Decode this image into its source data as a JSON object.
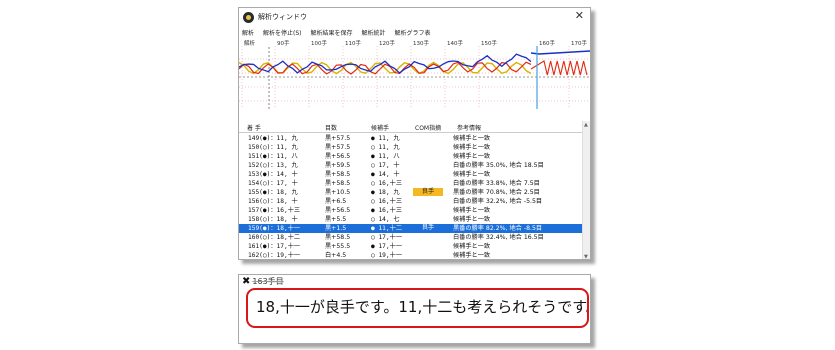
{
  "window": {
    "title": "解析ウィンドウ",
    "menu": [
      "解析",
      "解析を停止(S)",
      "解析結果を保存",
      "解析統計",
      "解析グラフ表"
    ]
  },
  "graph": {
    "move_ticks": [
      "解析",
      "90手",
      "100手",
      "110手",
      "120手",
      "130手",
      "140手",
      "150手",
      "160手",
      "170手"
    ],
    "colors": {
      "black_line": "#1a2fc4",
      "white_line": "#e02a12",
      "extra_line": "#d8b200",
      "grid_dots": "#e58a8a",
      "cursor": "#4aa0e8"
    }
  },
  "table": {
    "headers": {
      "move": "着 手",
      "score": "目数",
      "candidate": "候補手",
      "com": "COM指摘",
      "info": "参考情報"
    },
    "rows": [
      {
        "move": "149(●)：11, 九",
        "score": "黒+57.5",
        "cand": "● 11, 九",
        "com": "",
        "info": "候補手と一致"
      },
      {
        "move": "150(○)：11, 九",
        "score": "黒+57.5",
        "cand": "○ 11, 九",
        "com": "",
        "info": "候補手と一致"
      },
      {
        "move": "151(●)：11, 八",
        "score": "黒+56.5",
        "cand": "● 11, 八",
        "com": "",
        "info": "候補手と一致"
      },
      {
        "move": "152(○)：13, 九",
        "score": "黒+59.5",
        "cand": "○ 17, 十",
        "com": "",
        "info": "白番の勝率 35.0%, 地合 18.5目"
      },
      {
        "move": "153(●)：14, 十",
        "score": "黒+58.5",
        "cand": "● 14, 十",
        "com": "",
        "info": "候補手と一致"
      },
      {
        "move": "154(○)：17, 十",
        "score": "黒+58.5",
        "cand": "○ 16,十三",
        "com": "",
        "info": "白番の勝率 33.8%, 地合 7.5目"
      },
      {
        "move": "155(●)：18, 九",
        "score": "黒+10.5",
        "cand": "● 18, 九",
        "com": "良手",
        "info": "黒番の勝率 70.8%, 地合 2.5目"
      },
      {
        "move": "156(○)：18, 十",
        "score": "黒+6.5",
        "cand": "○ 16,十三",
        "com": "",
        "info": "白番の勝率 32.2%, 地合 -5.5目"
      },
      {
        "move": "157(●)：16,十三",
        "score": "黒+56.5",
        "cand": "● 16,十三",
        "com": "",
        "info": "候補手と一致"
      },
      {
        "move": "158(○)：18, 十",
        "score": "黒+5.5",
        "cand": "○ 14, 七",
        "com": "",
        "info": "候補手と一致"
      },
      {
        "move": "159(●)：18,十一",
        "score": "黒+1.5",
        "cand": "● 11,十二",
        "com": "良手",
        "info": "黒番の勝率 82.2%, 地合 -8.5目"
      },
      {
        "move": "160(○)：18,十二",
        "score": "黒+58.5",
        "cand": "○ 17,十一",
        "com": "",
        "info": "白番の勝率 32.4%, 地合 16.5目"
      },
      {
        "move": "161(●)：17,十一",
        "score": "黒+55.5",
        "cand": "● 17,十一",
        "com": "",
        "info": "候補手と一致"
      },
      {
        "move": "162(○)：19,十一",
        "score": "白+4.5",
        "cand": "○ 19,十一",
        "com": "",
        "info": "候補手と一致"
      }
    ],
    "selected_index": 10
  },
  "hint": {
    "title": "163手目",
    "message": "18,十一が良手です。11,十二も考えられそうです。"
  }
}
